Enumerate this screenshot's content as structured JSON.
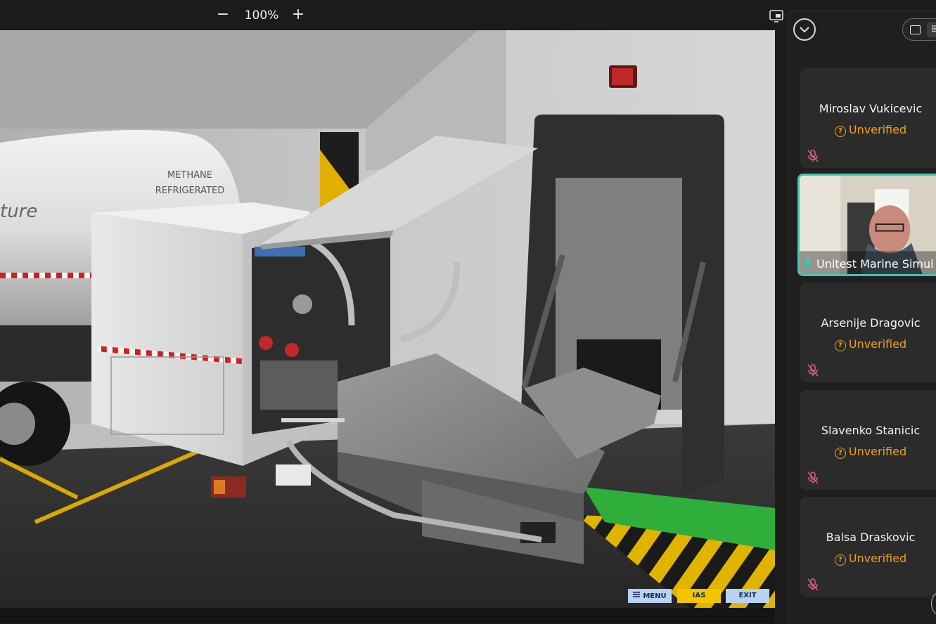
{
  "toolbar": {
    "zoom_out": "−",
    "zoom_level": "100%",
    "zoom_in": "+"
  },
  "scene": {
    "tank_label_line1": "METHANE",
    "tank_label_line2": "REFRIGERATED",
    "tank_brand_fragment": "ture"
  },
  "sim_controls": {
    "menu_label": "MENU",
    "ias_label": "IAS",
    "exit_label": "EXIT",
    "menu_color": "#b8d2f0",
    "ias_color": "#f4c400",
    "exit_color": "#b8d2f0"
  },
  "participants": [
    {
      "name": "Miroslav Vukicevic",
      "status": "Unverified"
    },
    {
      "name": "Unitest Marine Simul",
      "status": ""
    },
    {
      "name": "Arsenije Dragovic",
      "status": "Unverified"
    },
    {
      "name": "Slavenko Stanicic",
      "status": "Unverified"
    },
    {
      "name": "Balsa Draskovic",
      "status": "Unverified"
    }
  ],
  "colors": {
    "unverified": "#f0a020",
    "active_speaker_border": "#3fc6b4",
    "muted_mic": "#e06080"
  }
}
